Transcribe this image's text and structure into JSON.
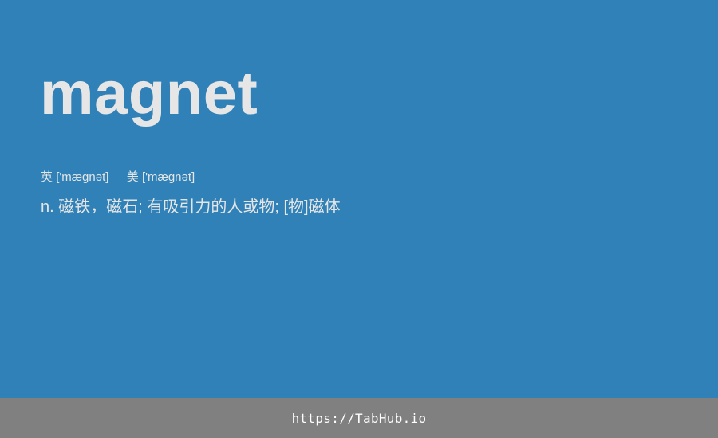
{
  "entry": {
    "word": "magnet",
    "phonetic_uk_label": "英",
    "phonetic_uk": "['mæɡnət]",
    "phonetic_us_label": "美",
    "phonetic_us": "['mæɡnət]",
    "definition": "n. 磁铁，磁石; 有吸引力的人或物; [物]磁体"
  },
  "footer": {
    "url": "https://TabHub.io"
  },
  "colors": {
    "background": "#2f81b7",
    "text": "#e6e6e6",
    "footer_background": "#808080",
    "footer_text": "#ffffff"
  }
}
